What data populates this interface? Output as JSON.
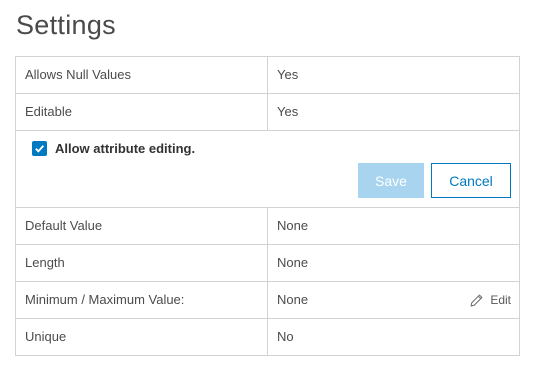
{
  "page": {
    "title": "Settings"
  },
  "rows_top": [
    {
      "label": "Allows Null Values",
      "value": "Yes"
    },
    {
      "label": "Editable",
      "value": "Yes"
    }
  ],
  "editor": {
    "checkbox_label": "Allow attribute editing.",
    "checked": true,
    "save_label": "Save",
    "cancel_label": "Cancel"
  },
  "rows_bottom": [
    {
      "label": "Default Value",
      "value": "None"
    },
    {
      "label": "Length",
      "value": "None"
    },
    {
      "label": "Minimum / Maximum Value:",
      "value": "None",
      "action": "Edit",
      "action_icon": "pencil-icon"
    },
    {
      "label": "Unique",
      "value": "No"
    }
  ],
  "colors": {
    "accent": "#0079c1",
    "disabled_button": "#a8d4ef",
    "border": "#d3d3d3"
  }
}
